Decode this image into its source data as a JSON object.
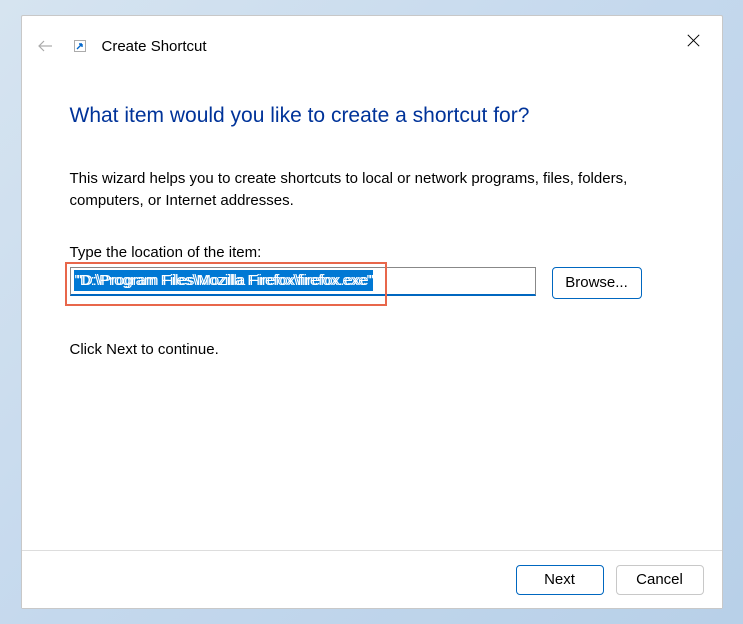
{
  "window": {
    "title": "Create Shortcut"
  },
  "main": {
    "heading": "What item would you like to create a shortcut for?",
    "description": "This wizard helps you to create shortcuts to local or network programs, files, folders, computers, or Internet addresses.",
    "location_label": "Type the location of the item:",
    "location_value": "\"D:\\Program Files\\Mozilla Firefox\\firefox.exe\"",
    "browse_label": "Browse...",
    "continue_text": "Click Next to continue."
  },
  "footer": {
    "next_label": "Next",
    "cancel_label": "Cancel"
  }
}
